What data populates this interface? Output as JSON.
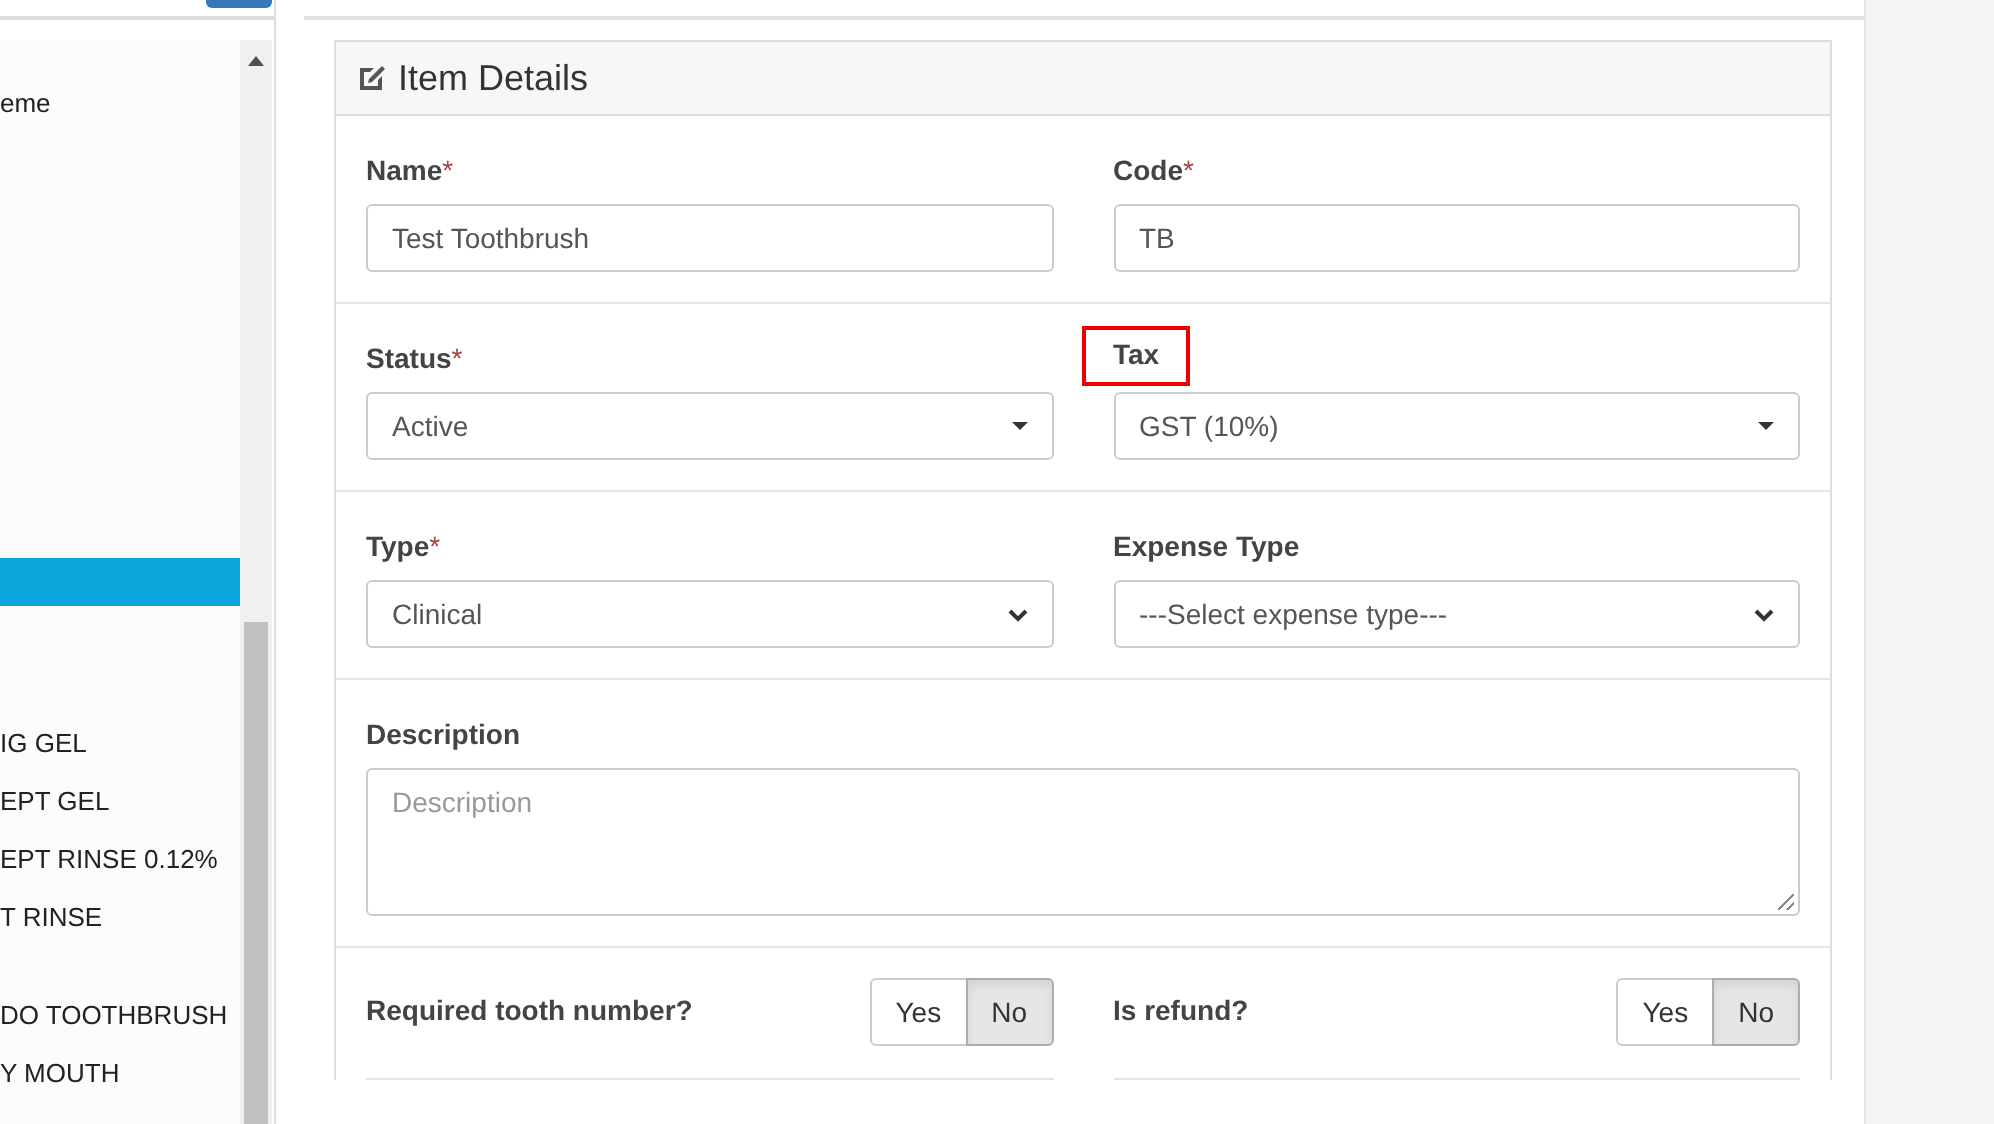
{
  "sidebar": {
    "items": [
      {
        "label": "eme",
        "selected": false
      },
      {
        "selected": true
      },
      {
        "label": "IG GEL",
        "selected": false
      },
      {
        "label": "EPT GEL",
        "selected": false
      },
      {
        "label": "EPT RINSE 0.12%",
        "selected": false
      },
      {
        "label": "T RINSE",
        "selected": false
      },
      {
        "label": "DO TOOTHBRUSH",
        "selected": false
      },
      {
        "label": "Y MOUTH",
        "selected": false
      }
    ]
  },
  "panel": {
    "title": "Item Details",
    "field_rows": [
      [
        {
          "label": "Name",
          "required_mark": "*",
          "kind": "input",
          "value": "Test Toothbrush"
        },
        {
          "label": "Code",
          "required_mark": "*",
          "kind": "input",
          "value": "TB"
        }
      ],
      [
        {
          "label": "Status",
          "required_mark": "*",
          "kind": "dropdown",
          "value": "Active"
        },
        {
          "label": "Tax",
          "highlighted": true,
          "kind": "dropdown",
          "value": "GST (10%)"
        }
      ],
      [
        {
          "label": "Type",
          "required_mark": "*",
          "kind": "select",
          "value": "Clinical"
        },
        {
          "label": "Expense Type",
          "kind": "select",
          "value": "---Select expense type---"
        }
      ],
      [
        {
          "label": "Description",
          "kind": "textarea",
          "placeholder": "Description"
        }
      ]
    ],
    "toggle_rows": [
      [
        {
          "label": "Required tooth number?",
          "options": [
            {
              "label": "Yes",
              "selected": false
            },
            {
              "label": "No",
              "selected": true
            }
          ]
        },
        {
          "label": "Is refund?",
          "options": [
            {
              "label": "Yes",
              "selected": false
            },
            {
              "label": "No",
              "selected": true
            }
          ]
        }
      ]
    ]
  }
}
